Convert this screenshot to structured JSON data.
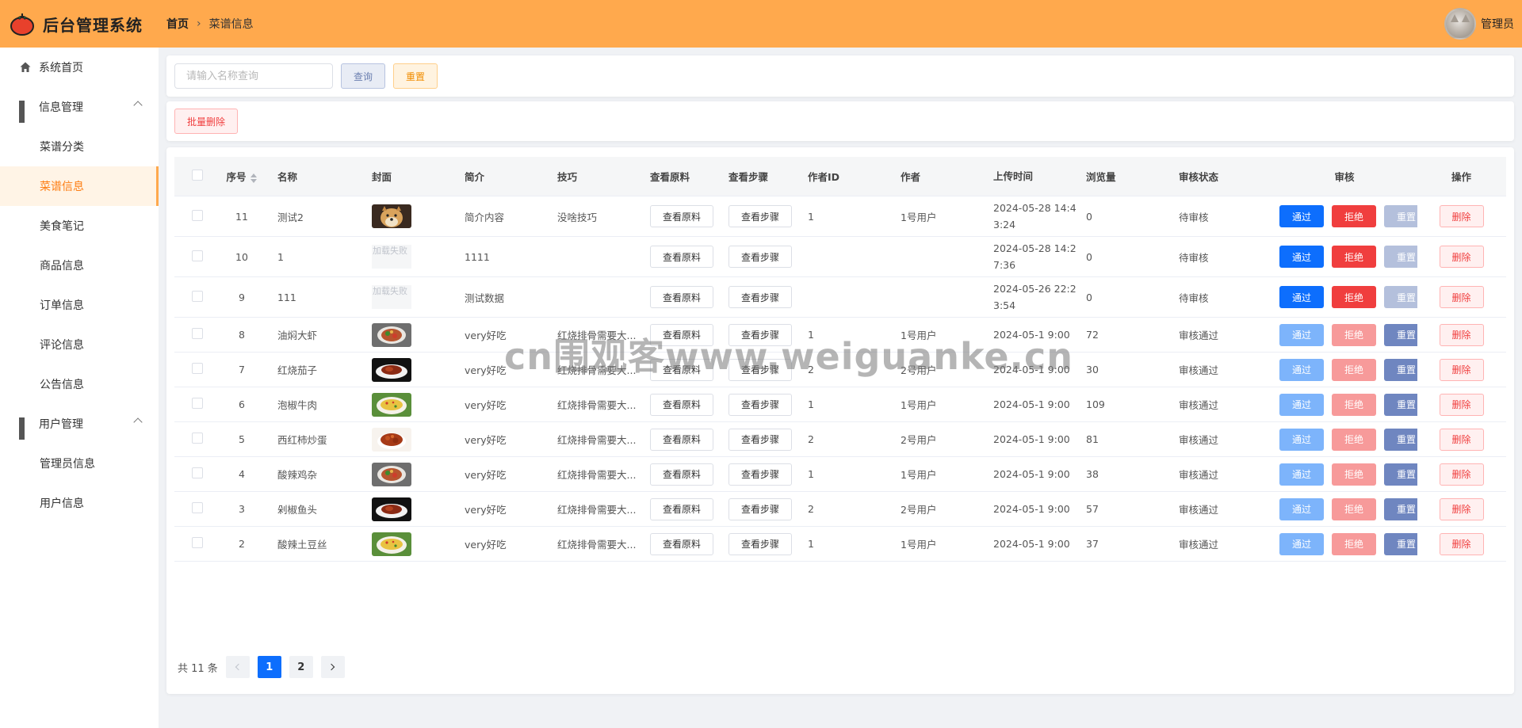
{
  "app": {
    "title": "后台管理系统"
  },
  "breadcrumb": {
    "home": "首页",
    "current": "菜谱信息"
  },
  "user": {
    "name": "管理员"
  },
  "sidebar": {
    "home": "系统首页",
    "group_info": "信息管理",
    "items": [
      "菜谱分类",
      "菜谱信息",
      "美食笔记",
      "商品信息",
      "订单信息",
      "评论信息",
      "公告信息"
    ],
    "group_user": "用户管理",
    "user_items": [
      "管理员信息",
      "用户信息"
    ]
  },
  "search": {
    "placeholder": "请输入名称查询",
    "query_label": "查询",
    "reset_label": "重置"
  },
  "actions": {
    "batch_delete": "批量删除"
  },
  "table": {
    "headers": {
      "seq": "序号",
      "name": "名称",
      "cover": "封面",
      "intro": "简介",
      "tip": "技巧",
      "materials": "查看原料",
      "steps": "查看步骤",
      "author_id": "作者ID",
      "author": "作者",
      "upload_time": "上传时间",
      "views": "浏览量",
      "audit_status": "审核状态",
      "audit": "审核",
      "op": "操作"
    },
    "button_labels": {
      "materials": "查看原料",
      "steps": "查看步骤",
      "pass": "通过",
      "reject": "拒绝",
      "reset": "重置",
      "delete": "删除"
    },
    "cover_fail_text": "加载失败",
    "rows": [
      {
        "seq": "11",
        "name": "测试2",
        "cover": "doge",
        "intro": "简介内容",
        "tip": "没啥技巧",
        "author_id": "1",
        "author": "1号用户",
        "time": "2024-05-28 14:43:24",
        "views": "0",
        "status": "待审核"
      },
      {
        "seq": "10",
        "name": "1",
        "cover": "fail",
        "intro": "1111",
        "tip": "",
        "author_id": "",
        "author": "",
        "time": "2024-05-28 14:27:36",
        "views": "0",
        "status": "待审核"
      },
      {
        "seq": "9",
        "name": "111",
        "cover": "fail",
        "intro": "测试数据",
        "tip": "",
        "author_id": "",
        "author": "",
        "time": "2024-05-26 22:23:54",
        "views": "0",
        "status": "待审核"
      },
      {
        "seq": "8",
        "name": "油焖大虾",
        "cover": "dish-a",
        "intro": "very好吃",
        "tip": "红烧排骨需要大...",
        "author_id": "1",
        "author": "1号用户",
        "time": "2024-05-1 9:00",
        "views": "72",
        "status": "审核通过"
      },
      {
        "seq": "7",
        "name": "红烧茄子",
        "cover": "dish-b",
        "intro": "very好吃",
        "tip": "红烧排骨需要大...",
        "author_id": "2",
        "author": "2号用户",
        "time": "2024-05-1 9:00",
        "views": "30",
        "status": "审核通过"
      },
      {
        "seq": "6",
        "name": "泡椒牛肉",
        "cover": "dish-c",
        "intro": "very好吃",
        "tip": "红烧排骨需要大...",
        "author_id": "1",
        "author": "1号用户",
        "time": "2024-05-1 9:00",
        "views": "109",
        "status": "审核通过"
      },
      {
        "seq": "5",
        "name": "西红柿炒蛋",
        "cover": "dish-d",
        "intro": "very好吃",
        "tip": "红烧排骨需要大...",
        "author_id": "2",
        "author": "2号用户",
        "time": "2024-05-1 9:00",
        "views": "81",
        "status": "审核通过"
      },
      {
        "seq": "4",
        "name": "酸辣鸡杂",
        "cover": "dish-a",
        "intro": "very好吃",
        "tip": "红烧排骨需要大...",
        "author_id": "1",
        "author": "1号用户",
        "time": "2024-05-1 9:00",
        "views": "38",
        "status": "审核通过"
      },
      {
        "seq": "3",
        "name": "剁椒鱼头",
        "cover": "dish-b",
        "intro": "very好吃",
        "tip": "红烧排骨需要大...",
        "author_id": "2",
        "author": "2号用户",
        "time": "2024-05-1 9:00",
        "views": "57",
        "status": "审核通过"
      },
      {
        "seq": "2",
        "name": "酸辣土豆丝",
        "cover": "dish-c",
        "intro": "very好吃",
        "tip": "红烧排骨需要大...",
        "author_id": "1",
        "author": "1号用户",
        "time": "2024-05-1 9:00",
        "views": "37",
        "status": "审核通过"
      }
    ]
  },
  "pagination": {
    "total_label": "共 11 条",
    "pages": [
      "1",
      "2"
    ],
    "current": "1"
  },
  "watermark": "cn围观客www.weiguanke.cn",
  "colors": {
    "header": "#ffa94d",
    "active": "#fd7e14",
    "primary": "#0d6efd",
    "danger": "#f03e3e"
  }
}
